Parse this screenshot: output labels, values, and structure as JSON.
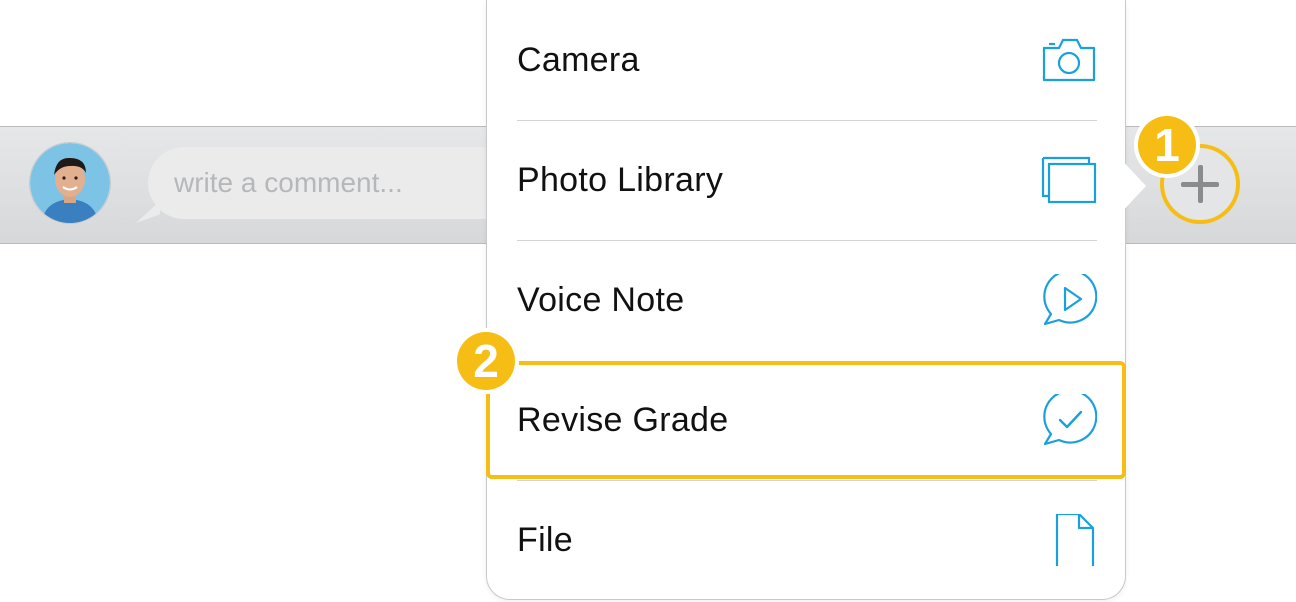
{
  "comment_bar": {
    "placeholder": "write a comment..."
  },
  "badges": {
    "step1": "1",
    "step2": "2"
  },
  "menu": {
    "items": [
      {
        "label": "Camera",
        "icon": "camera-icon"
      },
      {
        "label": "Photo Library",
        "icon": "photo-library-icon"
      },
      {
        "label": "Voice Note",
        "icon": "voice-note-icon"
      },
      {
        "label": "Revise Grade",
        "icon": "revise-grade-icon"
      },
      {
        "label": "File",
        "icon": "file-icon"
      }
    ]
  },
  "colors": {
    "accent": "#f6bd14",
    "icon_blue": "#1aa0dd",
    "bar_bg": "#e0e1e2"
  }
}
